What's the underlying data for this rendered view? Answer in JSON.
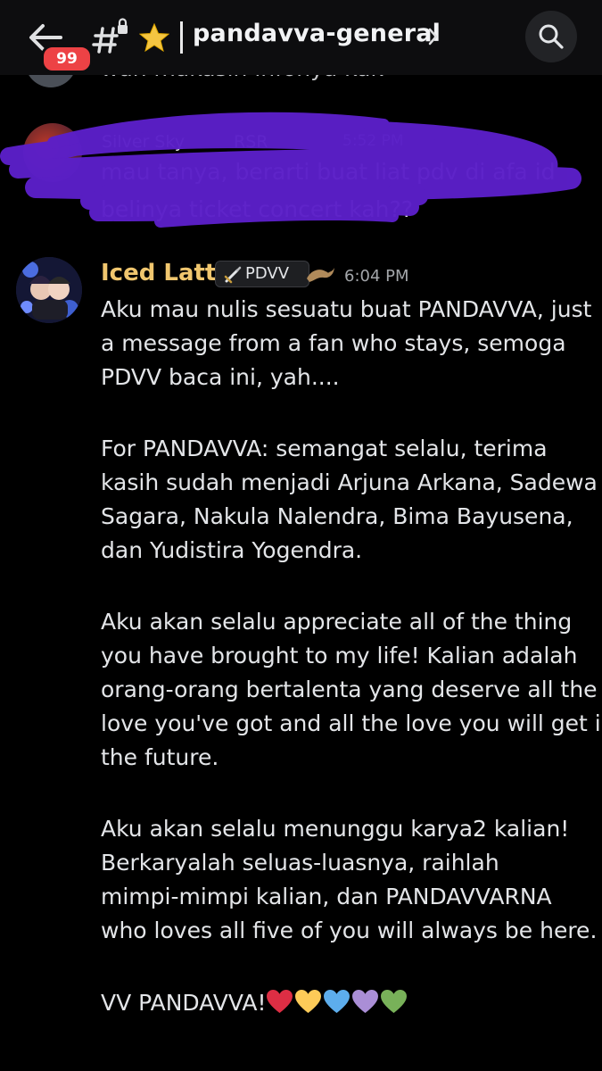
{
  "header": {
    "unread_badge": "99",
    "channel_name": "pandavva-general"
  },
  "previous_message": {
    "partial_text": "wah makasih infonya kak"
  },
  "scribbled_message": {
    "author_partial": "Silver Sky",
    "role_partial": "RSR",
    "timestamp": "5:52 PM",
    "lines": [
      "mau tanya, berarti buat liat pdv di afa id",
      "belinya ticket concert kah??"
    ]
  },
  "message": {
    "author": "Iced Latte",
    "role_tag": "PDVV",
    "timestamp": "6:04 PM",
    "lines": [
      "Aku mau nulis sesuatu buat PANDAVVA, just",
      "a message from a fan who stays, semoga",
      "PDVV baca ini, yah....",
      "For PANDAVVA: semangat selalu, terima",
      "kasih sudah menjadi Arjuna Arkana, Sadewa",
      "Sagara, Nakula Nalendra, Bima Bayusena,",
      "dan Yudistira Yogendra.",
      "Aku akan selalu appreciate all of the thing",
      "you have brought to my life! Kalian adalah",
      "orang-orang bertalenta yang deserve all the",
      "love you've got and all the love you will get in",
      "the future.",
      "Aku akan selalu menunggu karya2 kalian!",
      "Berkaryalah seluas-luasnya, raihlah",
      "mimpi-mimpi kalian, dan PANDAVVARNA",
      "who loves all five of you will always be here.",
      "VV PANDAVVA!"
    ],
    "hearts": [
      "#dd2e44",
      "#fdcb58",
      "#5dadec",
      "#aa8ed6",
      "#78b159"
    ]
  }
}
